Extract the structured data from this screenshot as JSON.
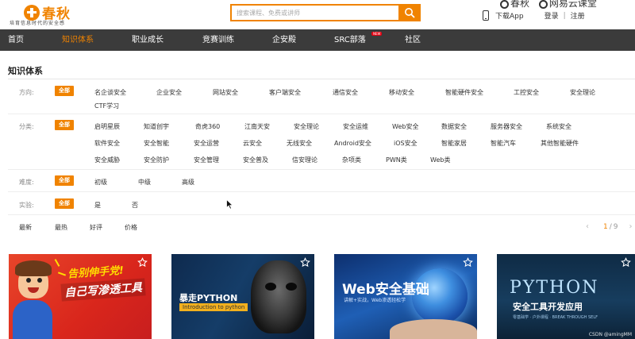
{
  "header": {
    "logo_text": "春秋",
    "slogan": "培育信息时代的安全感",
    "search_placeholder": "搜索课程、免费或讲师",
    "brand_strip": [
      "春秋",
      "网易云课堂"
    ],
    "download_app": "下载App",
    "login": "登录",
    "separator": "|",
    "register": "注册"
  },
  "nav": {
    "items": [
      "首页",
      "知识体系",
      "职业成长",
      "竞赛训练",
      "企安殿",
      "SRC部落",
      "社区"
    ],
    "active_index": 1,
    "badge": "NEW"
  },
  "filters": {
    "title": "知识体系",
    "rows": [
      {
        "label": "方向:",
        "selected": "全部",
        "options": [
          "名企谈安全",
          "企业安全",
          "网站安全",
          "客户端安全",
          "通信安全",
          "移动安全",
          "智能硬件安全",
          "工控安全",
          "安全理论",
          "CTF学习"
        ]
      },
      {
        "label": "分类:",
        "selected": "全部",
        "options": [
          "启明星辰",
          "知道创宇",
          "奇虎360",
          "江南天安",
          "安全理论",
          "安全运维",
          "Web安全",
          "数据安全",
          "服务器安全",
          "系统安全",
          "软件安全",
          "安全智能",
          "安全运营",
          "云安全",
          "无线安全",
          "Android安全",
          "iOS安全",
          "智能家居",
          "智能汽车",
          "其他智能硬件",
          "安全威胁",
          "安全防护",
          "安全管理",
          "安全普及",
          "信安理论",
          "杂项类",
          "PWN类",
          "Web类"
        ]
      },
      {
        "label": "难度:",
        "selected": "全部",
        "options": [
          "初级",
          "中级",
          "高级"
        ]
      },
      {
        "label": "实验:",
        "selected": "全部",
        "options": [
          "是",
          "否"
        ]
      }
    ]
  },
  "sort": {
    "options": [
      "最新",
      "最热",
      "好评",
      "价格"
    ],
    "pager": {
      "prev": "‹",
      "current": "1",
      "separator": "/",
      "total": "9",
      "next": "›"
    }
  },
  "cards": [
    {
      "title": "告别伸手党!",
      "subtitle": "自己写渗透工具"
    },
    {
      "title": "暴走PYTHON",
      "subtitle": "Introduction to python"
    },
    {
      "title": "Web安全基础",
      "subtitle": "讲解+实战，Web渗透轻松学"
    },
    {
      "title": "PYTHON",
      "subtitle": "安全工具开发应用",
      "tag": "零基础学 · 户外课程 · BREAK THROUGH SELF"
    }
  ],
  "watermark": "CSDN @amingMM",
  "colors": {
    "accent": "#f08300",
    "nav_bg": "#3b3b3b",
    "badge": "#e60012"
  }
}
